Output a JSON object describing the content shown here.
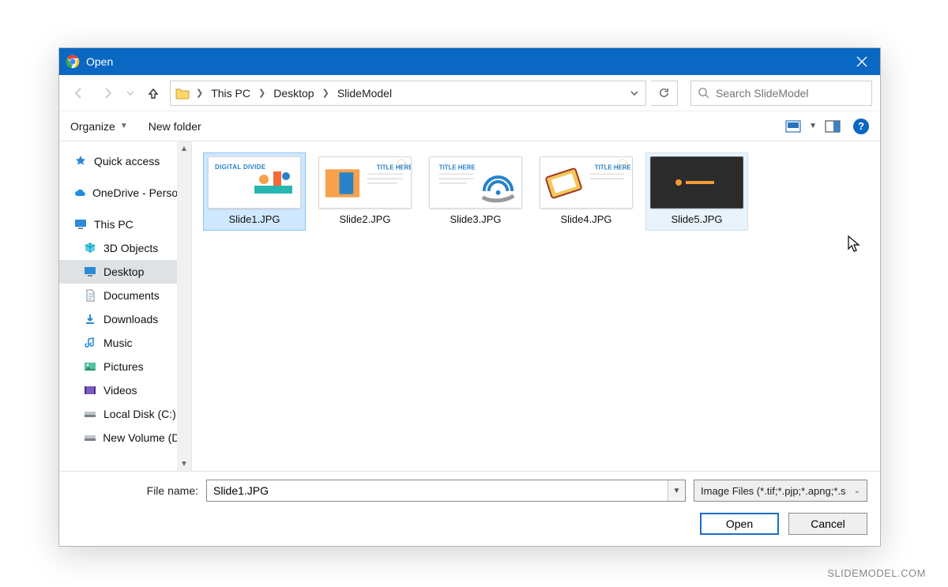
{
  "window": {
    "title": "Open"
  },
  "breadcrumb": {
    "parts": [
      "This PC",
      "Desktop",
      "SlideModel"
    ]
  },
  "search": {
    "placeholder": "Search SlideModel"
  },
  "toolbar": {
    "organize": "Organize",
    "newfolder": "New folder"
  },
  "sidebar": {
    "items": [
      {
        "label": "Quick access"
      },
      {
        "label": "OneDrive - Personal"
      },
      {
        "label": "This PC"
      },
      {
        "label": "3D Objects"
      },
      {
        "label": "Desktop"
      },
      {
        "label": "Documents"
      },
      {
        "label": "Downloads"
      },
      {
        "label": "Music"
      },
      {
        "label": "Pictures"
      },
      {
        "label": "Videos"
      },
      {
        "label": "Local Disk (C:)"
      },
      {
        "label": "New Volume (D:)"
      }
    ]
  },
  "files": {
    "items": [
      {
        "name": "Slide1.JPG",
        "title": "DIGITAL DIVIDE"
      },
      {
        "name": "Slide2.JPG",
        "title": "TITLE HERE"
      },
      {
        "name": "Slide3.JPG",
        "title": "TITLE HERE"
      },
      {
        "name": "Slide4.JPG",
        "title": "TITLE HERE"
      },
      {
        "name": "Slide5.JPG",
        "title": ""
      }
    ]
  },
  "footer": {
    "filename_label": "File name:",
    "filename_value": "Slide1.JPG",
    "filter": "Image Files (*.tif;*.pjp;*.apng;*.s",
    "open": "Open",
    "cancel": "Cancel"
  },
  "watermark": "SLIDEMODEL.COM"
}
